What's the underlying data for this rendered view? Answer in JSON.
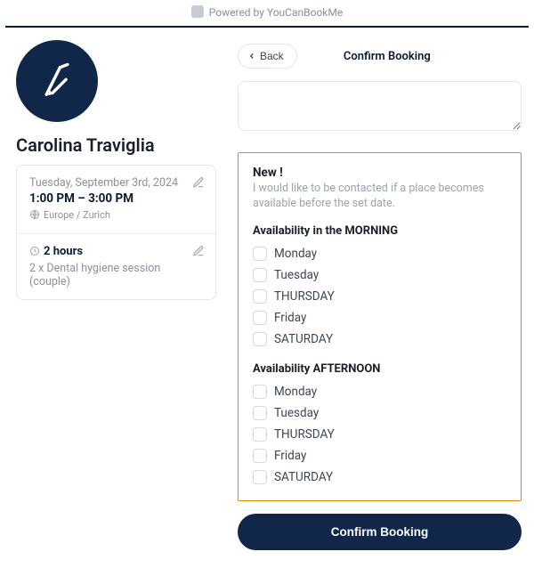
{
  "powered_by": "Powered by YouCanBookMe",
  "provider_name": "Carolina Traviglia",
  "date_line": "Tuesday, September 3rd, 2024",
  "time_range": "1:00 PM – 3:00 PM",
  "timezone": "Europe / Zurich",
  "duration_label": "2 hours",
  "service_line": "2 x Dental hygiene session (couple)",
  "back_label": "Back",
  "page_title": "Confirm Booking",
  "new_label": "New !",
  "new_desc": "I would like to be contacted if a place becomes available before the set date.",
  "morning_title": "Availability in the MORNING",
  "afternoon_title": "Availability AFTERNOON",
  "days": {
    "d1": "Monday",
    "d2": "Tuesday",
    "d3": "THURSDAY",
    "d4": "Friday",
    "d5": "SATURDAY"
  },
  "confirm_button": "Confirm Booking"
}
